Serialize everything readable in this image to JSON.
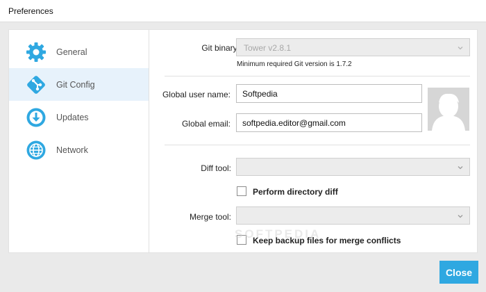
{
  "window": {
    "title": "Preferences"
  },
  "sidebar": {
    "items": [
      {
        "label": "General",
        "icon": "gear-icon"
      },
      {
        "label": "Git Config",
        "icon": "git-icon"
      },
      {
        "label": "Updates",
        "icon": "download-icon"
      },
      {
        "label": "Network",
        "icon": "globe-icon"
      }
    ],
    "active_index": 1,
    "accent_color": "#2fa8e1"
  },
  "form": {
    "git_binary": {
      "label": "Git binary:",
      "value": "Tower v2.8.1",
      "hint": "Minimum required Git version is 1.7.2"
    },
    "user_name": {
      "label": "Global user name:",
      "value": "Softpedia"
    },
    "email": {
      "label": "Global email:",
      "value": "softpedia.editor@gmail.com"
    },
    "diff_tool": {
      "label": "Diff tool:",
      "value": ""
    },
    "perform_dir_diff": {
      "label": "Perform directory diff",
      "checked": false
    },
    "merge_tool": {
      "label": "Merge tool:",
      "value": ""
    },
    "keep_backup": {
      "label": "Keep backup files for merge conflicts",
      "checked": false
    }
  },
  "watermark": "SOFTPEDIA",
  "footer": {
    "close_label": "Close",
    "close_color": "#2fa8e1"
  }
}
